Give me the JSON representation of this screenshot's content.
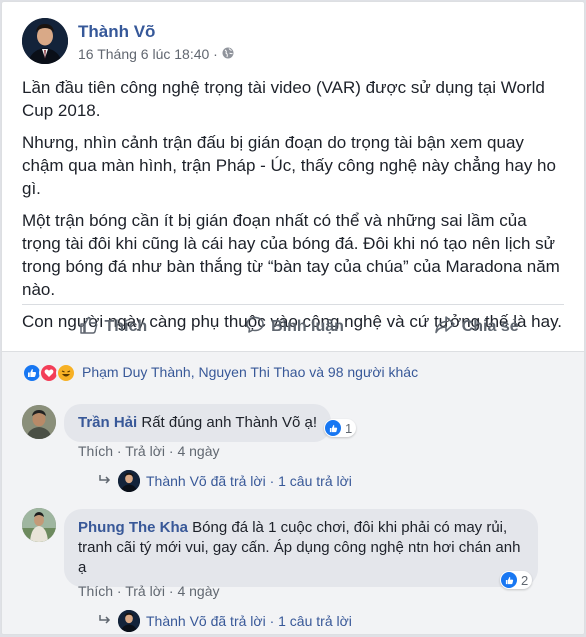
{
  "post": {
    "author": "Thành Võ",
    "timestamp": "16 Tháng 6 lúc 18:40 ·",
    "privacy_icon": "globe-icon",
    "paragraphs": [
      "Lần đầu tiên công nghệ trọng tài video (VAR) được sử dụng tại World Cup 2018.",
      "Nhưng, nhìn cảnh trận đấu bị gián đoạn do trọng tài bận xem quay chậm qua màn hình, trận Pháp - Úc, thấy công nghệ này chẳng hay ho gì.",
      "Một trận bóng cần ít bị gián đoạn nhất có thể và những sai lầm của trọng tài đôi khi cũng là cái hay của bóng đá. Đôi khi nó tạo nên lịch sử trong bóng đá như bàn thắng từ “bàn tay của chúa” của Maradona năm nào.",
      "Con người ngày càng phụ thuộc vào công nghệ và cứ tưởng thế là hay."
    ]
  },
  "actions": {
    "like": "Thích",
    "comment": "Bình luận",
    "share": "Chia sẻ"
  },
  "reactions": {
    "icons": [
      "like-icon",
      "love-icon",
      "haha-icon"
    ],
    "summary": "Phạm Duy Thành, Nguyen Thi Thao và 98 người khác"
  },
  "comments": [
    {
      "author": "Trần Hải",
      "text": "Rất đúng anh Thành Võ ạ!",
      "like_count": "1",
      "like_label": "Thích",
      "reply_label": "Trả lời",
      "time": "4 ngày",
      "reply_summary": "Thành Võ đã trả lời · 1 câu trả lời"
    },
    {
      "author": "Phung The Kha",
      "text": "Bóng đá là 1 cuộc chơi, đôi khi phải có may rủi, tranh cãi tý mới vui, gay cấn. Áp dụng công nghệ ntn hơi chán anh ạ",
      "like_count": "2",
      "like_label": "Thích",
      "reply_label": "Trả lời",
      "time": "4 ngày",
      "reply_summary": "Thành Võ đã trả lời · 1 câu trả lời"
    }
  ],
  "colors": {
    "link_blue": "#385898",
    "like_blue": "#1877f2",
    "love_red": "#f33e58",
    "haha_yellow": "#f7b125"
  }
}
